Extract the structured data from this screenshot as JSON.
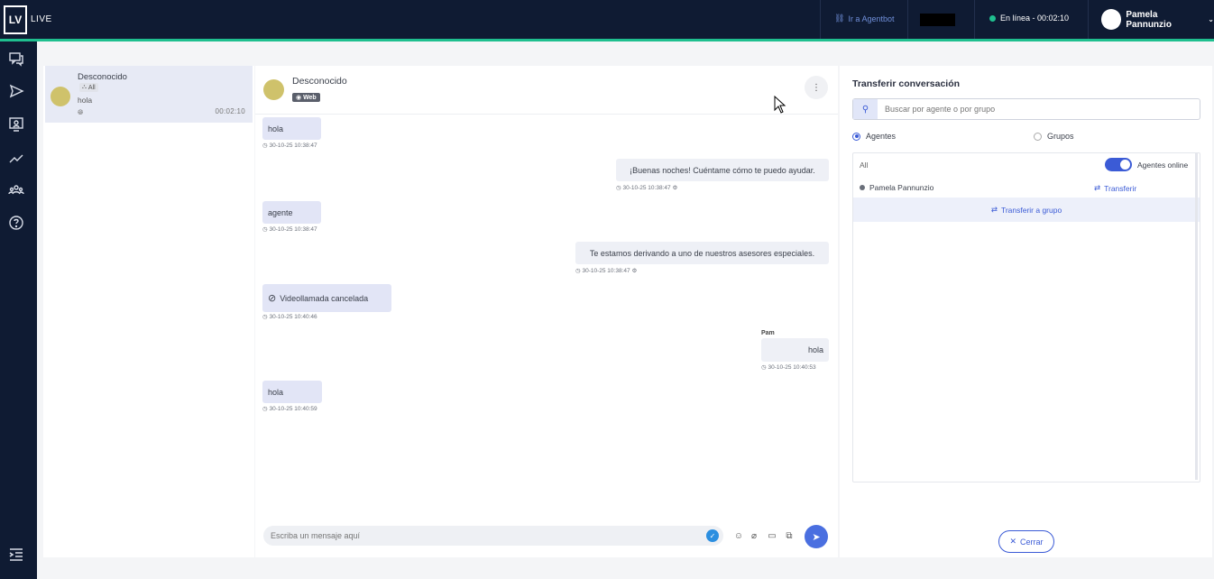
{
  "topbar": {
    "logo": "LV",
    "product": "LIVE",
    "agentbot_link": "Ir a Agentbot",
    "status": "En línea - 00:02:10",
    "user": "Pamela Pannunzio"
  },
  "nav": {
    "icons": [
      "chat-icon",
      "send-icon",
      "monitor-user-icon",
      "trend-icon",
      "team-icon",
      "help-icon",
      "collapse-menu-icon"
    ]
  },
  "conversations": [
    {
      "name": "Desconocido",
      "tag": "All",
      "last_message": "hola",
      "time": "00:02:10"
    }
  ],
  "chat": {
    "contact": "Desconocido",
    "channel": "Web",
    "composer_placeholder": "Escriba un mensaje aquí",
    "messages": [
      {
        "dir": "in",
        "text": "hola",
        "ts": "30-10-25 10:38:47"
      },
      {
        "dir": "out",
        "text": "¡Buenas noches! Cuéntame cómo te puedo ayudar.",
        "ts": "30-10-25 10:38:47"
      },
      {
        "dir": "in",
        "text": "agente",
        "ts": "30-10-25 10:38:47"
      },
      {
        "dir": "out",
        "text": "Te estamos derivando a uno de nuestros asesores especiales.",
        "ts": "30-10-25 10:38:47"
      },
      {
        "dir": "in",
        "text": "Videollamada cancelada",
        "ts": "30-10-25 10:40:46"
      },
      {
        "dir": "out",
        "sender": "Pam",
        "text": "hola",
        "ts": "30-10-25 10:40:53"
      },
      {
        "dir": "in",
        "text": "hola",
        "ts": "30-10-25 10:40:59"
      }
    ]
  },
  "transfer": {
    "title": "Transferir conversación",
    "search_placeholder": "Buscar por agente o por grupo",
    "radio_agents": "Agentes",
    "radio_groups": "Grupos",
    "filter_all": "All",
    "toggle_label": "Agentes online",
    "agent_name": "Pamela Pannunzio",
    "transfer_label": "Transferir",
    "transfer_group_label": "Transferir a grupo",
    "close_label": "Cerrar"
  },
  "colors": {
    "topbar": "#0f1b33",
    "accent": "#1fbf8f",
    "primary": "#3b5bd6"
  }
}
